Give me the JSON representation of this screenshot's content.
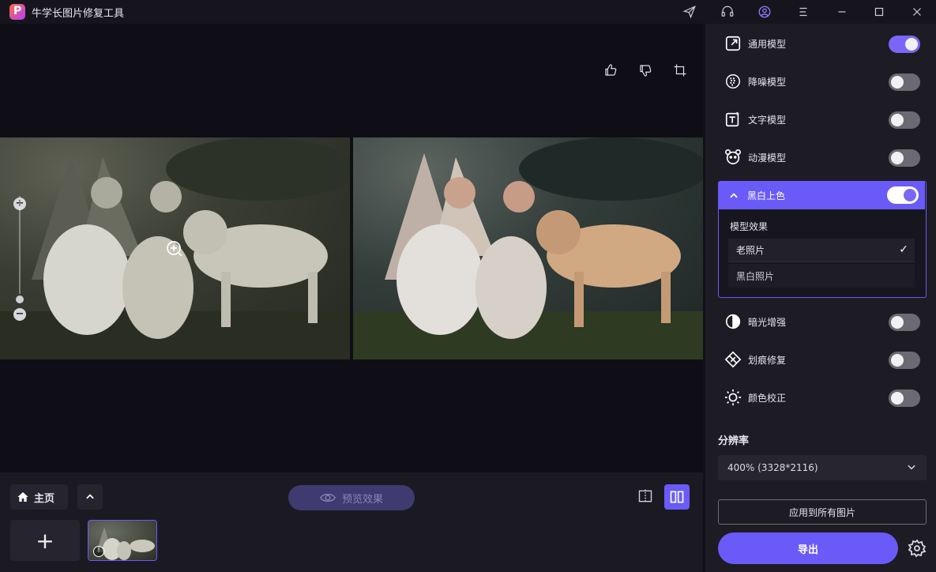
{
  "app": {
    "title": "牛学长图片修复工具"
  },
  "models": [
    {
      "label": "通用模型",
      "icon": "expand-icon",
      "enabled": true
    },
    {
      "label": "降噪模型",
      "icon": "denoise-icon",
      "enabled": false
    },
    {
      "label": "文字模型",
      "icon": "text-icon",
      "enabled": false
    },
    {
      "label": "动漫模型",
      "icon": "anime-icon",
      "enabled": false
    }
  ],
  "colorize": {
    "label": "黑白上色",
    "enabled": true,
    "effect_title": "模型效果",
    "options": [
      {
        "label": "老照片",
        "selected": true
      },
      {
        "label": "黑白照片",
        "selected": false
      }
    ]
  },
  "enhancements": [
    {
      "label": "暗光增强",
      "icon": "contrast-icon",
      "enabled": false
    },
    {
      "label": "划痕修复",
      "icon": "scratch-icon",
      "enabled": false
    },
    {
      "label": "颜色校正",
      "icon": "brightness-icon",
      "enabled": false
    }
  ],
  "resolution": {
    "title": "分辨率",
    "value": "400% (3328*2116)"
  },
  "buttons": {
    "apply_all": "应用到所有图片",
    "export": "导出",
    "preview": "预览效果",
    "home": "主页"
  },
  "colors": {
    "accent": "#6a5af7",
    "panel": "#1d1c25",
    "canvas": "#0f0e16"
  }
}
